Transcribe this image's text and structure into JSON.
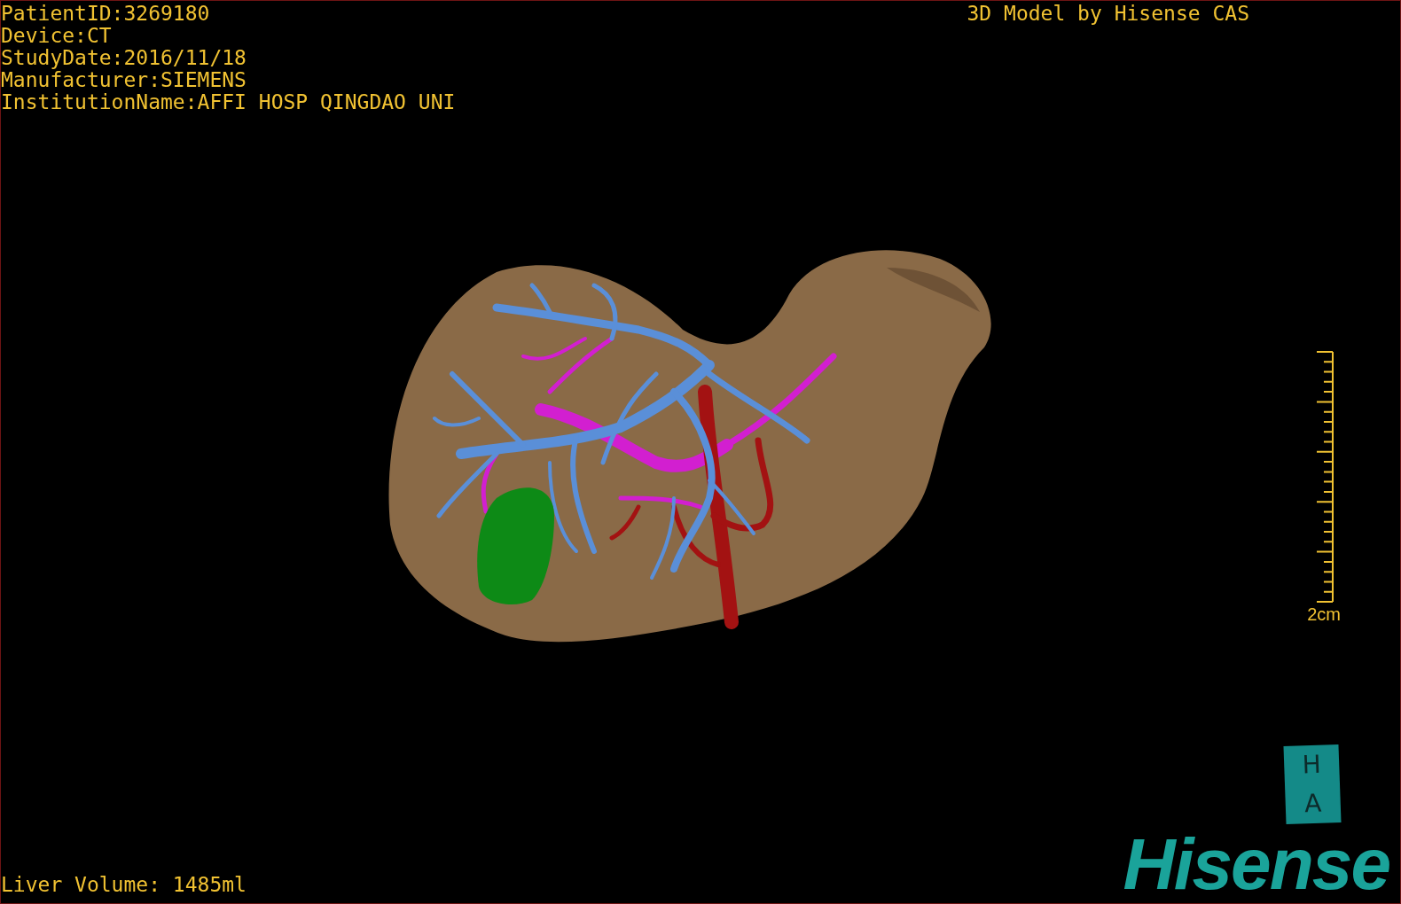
{
  "patient_info": [
    "PatientID:3269180",
    "Device:CT",
    "StudyDate:2016/11/18",
    "Manufacturer:SIEMENS",
    "InstitutionName:AFFI HOSP QINGDAO UNI"
  ],
  "title": "3D Model by Hisense CAS",
  "scale_bar": {
    "label": "2cm"
  },
  "liver_volume": "Liver Volume: 1485ml",
  "orientation_cube": {
    "top": "H",
    "front": "A"
  },
  "logo": "Hisense"
}
